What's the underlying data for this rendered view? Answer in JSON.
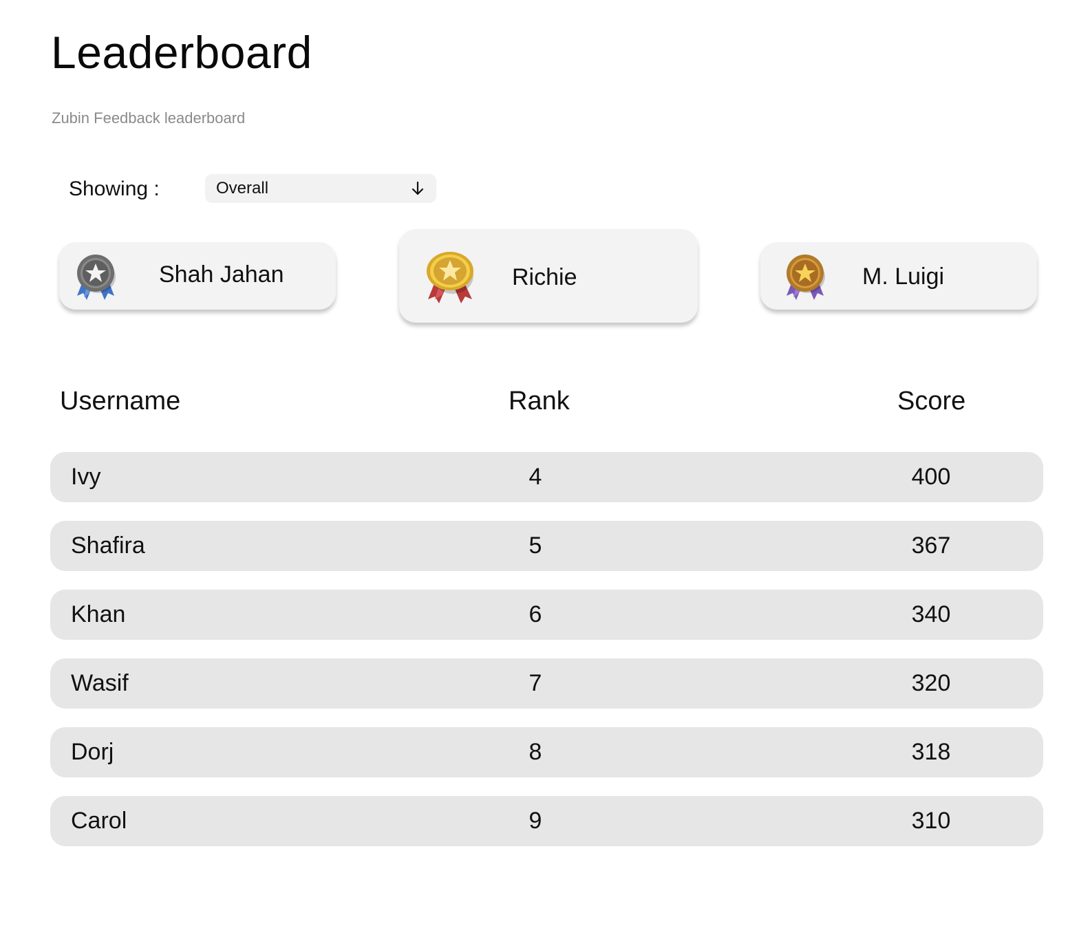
{
  "page": {
    "title": "Leaderboard",
    "subtitle": "Zubin Feedback leaderboard"
  },
  "filter": {
    "label": "Showing  :",
    "selected": "Overall",
    "arrow_icon": "arrow-down-icon"
  },
  "podium": [
    {
      "name": "Shah Jahan",
      "medal": "silver-medal-icon",
      "ribbon_color": "#3f74c8",
      "medal_color": "#7a7a7a"
    },
    {
      "name": "Richie",
      "medal": "gold-medal-icon",
      "ribbon_color": "#b83a3a",
      "medal_color": "#e8c23a"
    },
    {
      "name": "M. Luigi",
      "medal": "bronze-medal-icon",
      "ribbon_color": "#7a58b8",
      "medal_color": "#c88a32"
    }
  ],
  "table": {
    "headers": {
      "username": "Username",
      "rank": "Rank",
      "score": "Score"
    },
    "rows": [
      {
        "username": "Ivy",
        "rank": "4",
        "score": "400"
      },
      {
        "username": "Shafira",
        "rank": "5",
        "score": "367"
      },
      {
        "username": "Khan",
        "rank": "6",
        "score": "340"
      },
      {
        "username": "Wasif",
        "rank": "7",
        "score": "320"
      },
      {
        "username": "Dorj",
        "rank": "8",
        "score": "318"
      },
      {
        "username": "Carol",
        "rank": "9",
        "score": "310"
      }
    ]
  }
}
